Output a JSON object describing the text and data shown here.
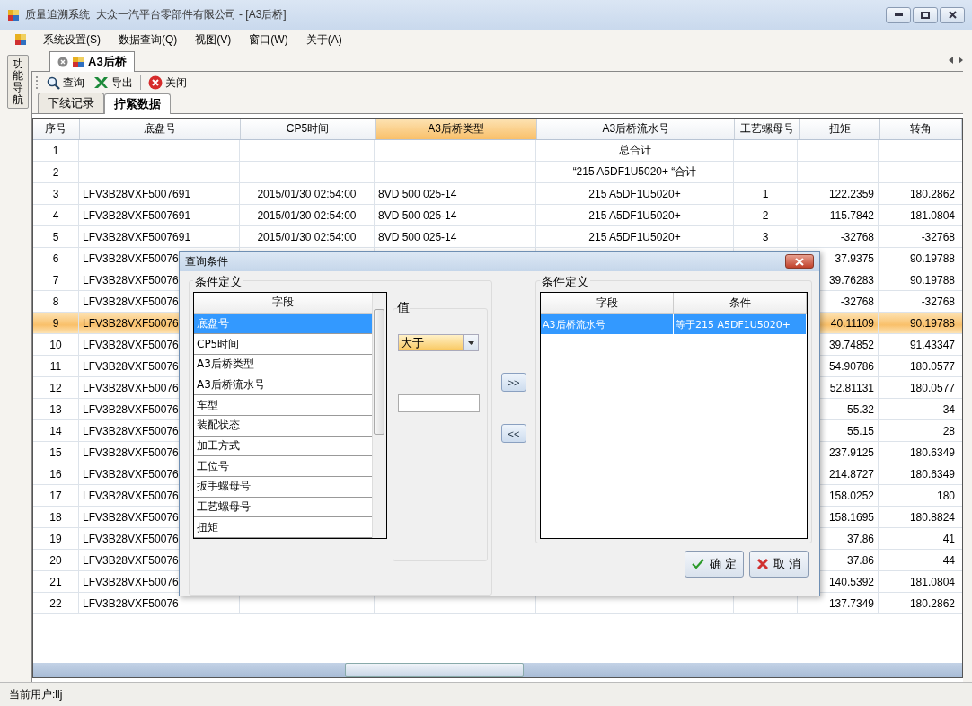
{
  "window": {
    "title": "质量追溯系统  大众一汽平台零部件有限公司 - [A3后桥]"
  },
  "menu": [
    {
      "label": "系统设置(S)"
    },
    {
      "label": "数据查询(Q)"
    },
    {
      "label": "视图(V)"
    },
    {
      "label": "窗口(W)"
    },
    {
      "label": "关于(A)"
    }
  ],
  "side_nav": {
    "label": "功能导航"
  },
  "doc_tabs": [
    {
      "label": "A3后桥",
      "selected": true
    }
  ],
  "toolbar": [
    {
      "label": "查询",
      "kind": "search"
    },
    {
      "label": "导出",
      "kind": "export"
    },
    {
      "label": "关闭",
      "kind": "close"
    }
  ],
  "sub_tabs": [
    {
      "label": "下线记录",
      "selected": false
    },
    {
      "label": "拧紧数据",
      "selected": true
    }
  ],
  "table": {
    "columns": [
      {
        "label": "序号",
        "selected": false
      },
      {
        "label": "底盘号",
        "selected": false
      },
      {
        "label": "CP5时间",
        "selected": false
      },
      {
        "label": "A3后桥类型",
        "selected": true
      },
      {
        "label": "A3后桥流水号",
        "selected": false
      },
      {
        "label": "工艺螺母号",
        "selected": false
      },
      {
        "label": "扭矩",
        "selected": false
      },
      {
        "label": "转角",
        "selected": false
      }
    ],
    "rows": [
      {
        "seq": "1",
        "serial": "总合计",
        "selected": false
      },
      {
        "seq": "2",
        "serial": "“215 A5DF1U5020+ “合计",
        "selected": false
      },
      {
        "seq": "3",
        "chassis": "LFV3B28VXF5007691",
        "time": "2015/01/30 02:54:00",
        "type": "8VD 500 025-14",
        "serial": "215 A5DF1U5020+",
        "nut": "1",
        "torque": "122.2359",
        "angle": "180.2862",
        "selected": false
      },
      {
        "seq": "4",
        "chassis": "LFV3B28VXF5007691",
        "time": "2015/01/30 02:54:00",
        "type": "8VD 500 025-14",
        "serial": "215 A5DF1U5020+",
        "nut": "2",
        "torque": "115.7842",
        "angle": "181.0804",
        "selected": false
      },
      {
        "seq": "5",
        "chassis": "LFV3B28VXF5007691",
        "time": "2015/01/30 02:54:00",
        "type": "8VD 500 025-14",
        "serial": "215 A5DF1U5020+",
        "nut": "3",
        "torque": "-32768",
        "angle": "-32768",
        "selected": false
      },
      {
        "seq": "6",
        "chassis": "LFV3B28VXF50076",
        "torque": "37.9375",
        "angle": "90.19788",
        "selected": false
      },
      {
        "seq": "7",
        "chassis": "LFV3B28VXF50076",
        "torque": "39.76283",
        "angle": "90.19788",
        "selected": false
      },
      {
        "seq": "8",
        "chassis": "LFV3B28VXF50076",
        "torque": "-32768",
        "angle": "-32768",
        "selected": false
      },
      {
        "seq": "9",
        "chassis": "LFV3B28VXF50076",
        "torque": "40.11109",
        "angle": "90.19788",
        "selected": true
      },
      {
        "seq": "10",
        "chassis": "LFV3B28VXF50076",
        "torque": "39.74852",
        "angle": "91.43347",
        "selected": false
      },
      {
        "seq": "11",
        "chassis": "LFV3B28VXF50076",
        "torque": "54.90786",
        "angle": "180.0577",
        "selected": false
      },
      {
        "seq": "12",
        "chassis": "LFV3B28VXF50076",
        "torque": "52.81131",
        "angle": "180.0577",
        "selected": false
      },
      {
        "seq": "13",
        "chassis": "LFV3B28VXF50076",
        "torque": "55.32",
        "angle": "34",
        "selected": false
      },
      {
        "seq": "14",
        "chassis": "LFV3B28VXF50076",
        "torque": "55.15",
        "angle": "28",
        "selected": false
      },
      {
        "seq": "15",
        "chassis": "LFV3B28VXF50076",
        "torque": "237.9125",
        "angle": "180.6349",
        "selected": false
      },
      {
        "seq": "16",
        "chassis": "LFV3B28VXF50076",
        "torque": "214.8727",
        "angle": "180.6349",
        "selected": false
      },
      {
        "seq": "17",
        "chassis": "LFV3B28VXF50076",
        "torque": "158.0252",
        "angle": "180",
        "selected": false
      },
      {
        "seq": "18",
        "chassis": "LFV3B28VXF50076",
        "torque": "158.1695",
        "angle": "180.8824",
        "selected": false
      },
      {
        "seq": "19",
        "chassis": "LFV3B28VXF50076",
        "torque": "37.86",
        "angle": "41",
        "selected": false
      },
      {
        "seq": "20",
        "chassis": "LFV3B28VXF50076",
        "torque": "37.86",
        "angle": "44",
        "selected": false
      },
      {
        "seq": "21",
        "chassis": "LFV3B28VXF50076",
        "torque": "140.5392",
        "angle": "181.0804",
        "selected": false
      },
      {
        "seq": "22",
        "chassis": "LFV3B28VXF50076",
        "torque": "137.7349",
        "angle": "180.2862",
        "selected": false
      }
    ]
  },
  "dialog": {
    "title": "查询条件",
    "left_group": {
      "title": "条件定义",
      "header": "字段",
      "items": [
        {
          "label": "底盘号",
          "selected": true
        },
        {
          "label": "CP5时间",
          "selected": false
        },
        {
          "label": "A3后桥类型",
          "selected": false
        },
        {
          "label": "A3后桥流水号",
          "selected": false
        },
        {
          "label": "车型",
          "selected": false
        },
        {
          "label": "装配状态",
          "selected": false
        },
        {
          "label": "加工方式",
          "selected": false
        },
        {
          "label": "工位号",
          "selected": false
        },
        {
          "label": "扳手螺母号",
          "selected": false
        },
        {
          "label": "工艺螺母号",
          "selected": false
        },
        {
          "label": "扭矩",
          "selected": false
        }
      ]
    },
    "value_group": {
      "title": "值",
      "operator": "大于"
    },
    "add_button": ">>",
    "remove_button": "<<",
    "right_group": {
      "title": "条件定义",
      "columns": [
        "字段",
        "条件"
      ],
      "rows": [
        {
          "field": "A3后桥流水号",
          "condition": "等于215 A5DF1U5020+",
          "selected": true
        }
      ]
    },
    "buttons": [
      {
        "label": "确 定",
        "kind": "ok"
      },
      {
        "label": "取 消",
        "kind": "cancel"
      }
    ]
  },
  "status_bar": {
    "text": "当前用户:llj"
  }
}
